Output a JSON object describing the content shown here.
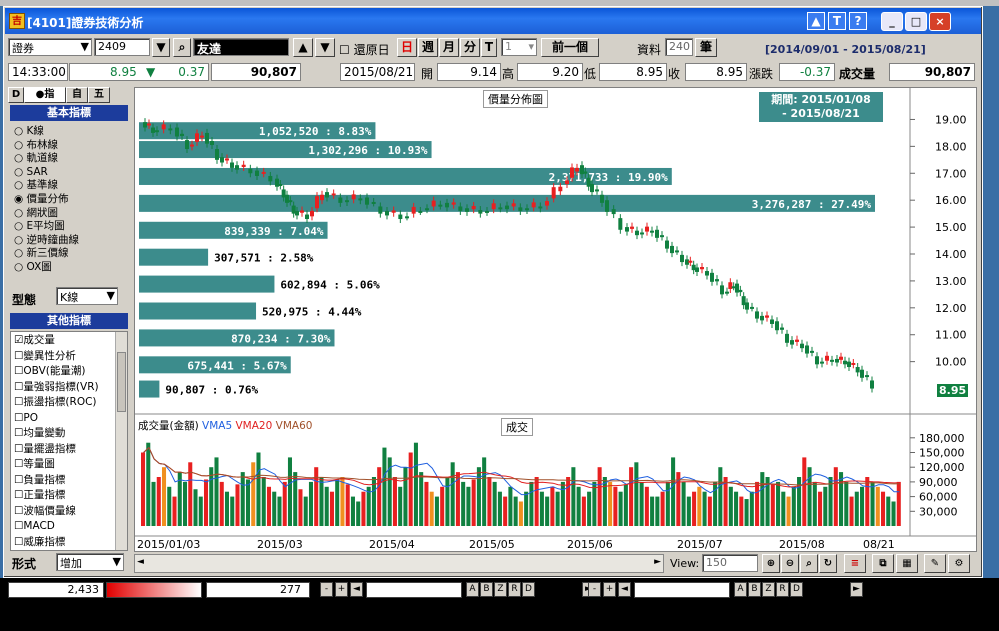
{
  "window": {
    "title": "[4101]證券技術分析",
    "btn_up": "▲",
    "btn_t": "T",
    "btn_help": "?",
    "min": "_",
    "max": "□",
    "close": "×"
  },
  "toolbar": {
    "market": "證券",
    "code": "2409",
    "name": "友達",
    "restore_label": "還原日",
    "period_day": "日",
    "period_week": "週",
    "period_month": "月",
    "period_min": "分",
    "period_tick": "T",
    "period_count": "1",
    "prev_label": "前一個",
    "data_label": "資料",
    "data_count": "240",
    "unit": "筆",
    "date_range": "[2014/09/01 - 2015/08/21]"
  },
  "quote": {
    "time": "14:33:00",
    "price": "8.95",
    "change_arrow": "▼",
    "change": "0.37",
    "volume": "90,807",
    "date": "2015/08/21",
    "open_label": "開",
    "open": "9.14",
    "high_label": "高",
    "high": "9.20",
    "low_label": "低",
    "low": "8.95",
    "close_label": "收",
    "close": "8.95",
    "chg_label": "漲跌",
    "chg": "-0.37",
    "vol_label": "成交量",
    "vol": "90,807"
  },
  "left": {
    "tab1": "D",
    "tab2": "●指",
    "tab3": "自",
    "tab4": "五",
    "basic_header": "基本指標",
    "basic_items": [
      "K線",
      "布林線",
      "軌道線",
      "SAR",
      "基準線",
      "價量分佈",
      "網狀圖",
      "E平均圖",
      "逆時鐘曲線",
      "新三價線",
      "OX圖"
    ],
    "selected_basic": 5,
    "type_label": "型態",
    "type_value": "K線",
    "other_header": "其他指標",
    "other_items": [
      "成交量",
      "變異性分析",
      "OBV(能量潮)",
      "量強弱指標(VR)",
      "振盪指標(ROC)",
      "PO",
      "均量變動",
      "量擺盪指標",
      "等量圖",
      "負量指標",
      "正量指標",
      "波幅價量線",
      "MACD",
      "威廉指標"
    ],
    "other_checked": 0,
    "form_label": "形式",
    "form_value": "增加"
  },
  "chart": {
    "title": "價量分佈圖",
    "period_line1": "期間: 2015/01/08",
    "period_line2": "- 2015/08/21",
    "last_price": "8.95",
    "vol_title": "成交",
    "vol_legend": {
      "main": "成交量(金額)",
      "vma5": "VMA5",
      "vma20": "VMA20",
      "vma60": "VMA60"
    },
    "view_label": "View:",
    "view_value": "150",
    "colors": {
      "up": "#e82020",
      "down": "#108040",
      "bar": "#3c8c8c",
      "vma5": "#2060e0",
      "vma20": "#e02020",
      "vma60": "#a0502a"
    }
  },
  "chart_data": {
    "type": "bar",
    "title": "價量分佈圖",
    "price_axis": [
      "19.00",
      "18.00",
      "17.00",
      "16.00",
      "15.00",
      "14.00",
      "13.00",
      "12.00",
      "11.00",
      "10.00"
    ],
    "volume_axis": [
      "180,000",
      "150,000",
      "120,000",
      "90,000",
      "60,000",
      "30,000"
    ],
    "x_labels": [
      "2015/01/03",
      "2015/03",
      "2015/04",
      "2015/05",
      "2015/06",
      "2015/07",
      "2015/08",
      "08/21"
    ],
    "price_range": [
      8.5,
      19.5
    ],
    "volume_profile": [
      {
        "price": 18.6,
        "label": "1,052,520 : 8.83%",
        "value": 1052520
      },
      {
        "price": 17.9,
        "label": "1,302,296 : 10.93%",
        "value": 1302296
      },
      {
        "price": 16.9,
        "label": "2,371,733 : 19.90%",
        "value": 2371733
      },
      {
        "price": 15.9,
        "label": "3,276,287 : 27.49%",
        "value": 3276287
      },
      {
        "price": 14.9,
        "label": "839,339 : 7.04%",
        "value": 839339
      },
      {
        "price": 13.9,
        "label": "307,571 : 2.58%",
        "value": 307571
      },
      {
        "price": 12.9,
        "label": "602,894 : 5.06%",
        "value": 602894
      },
      {
        "price": 11.9,
        "label": "520,975 : 4.44%",
        "value": 520975
      },
      {
        "price": 10.9,
        "label": "870,234 : 7.30%",
        "value": 870234
      },
      {
        "price": 9.9,
        "label": "675,441 : 5.67%",
        "value": 675441
      },
      {
        "price": 9.0,
        "label": "90,807 : 0.76%",
        "value": 90807
      }
    ]
  },
  "status": {
    "left_value": "2,433",
    "mid_value": "277"
  }
}
